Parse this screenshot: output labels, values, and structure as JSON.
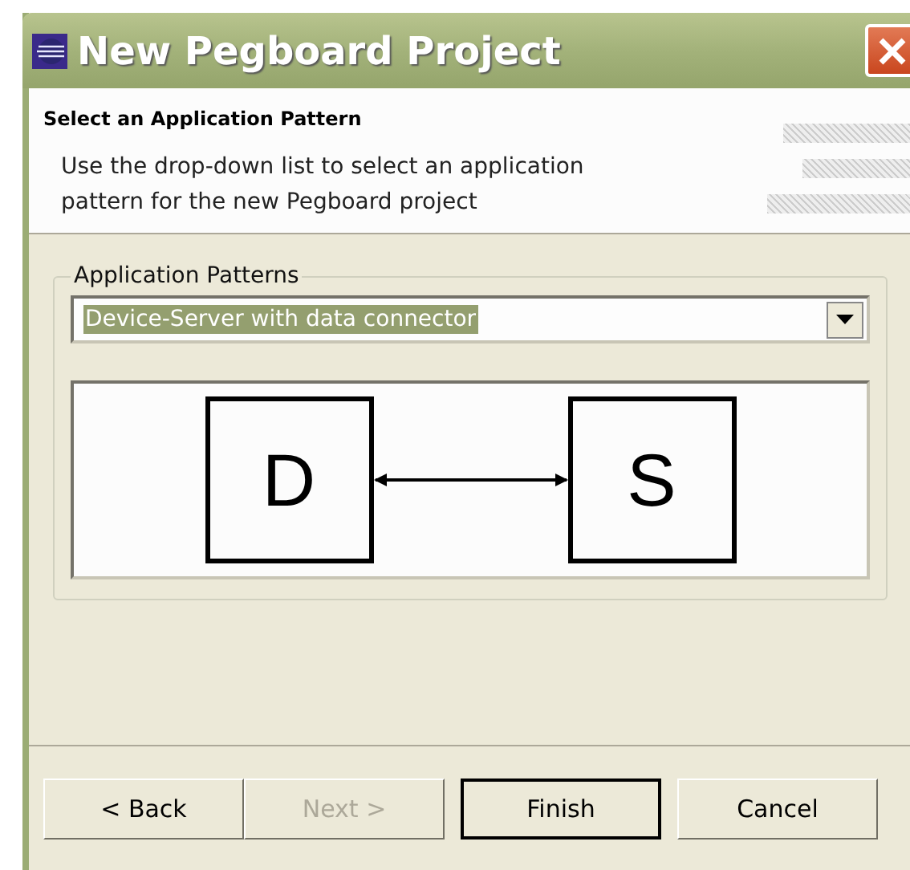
{
  "window": {
    "title": "New Pegboard Project"
  },
  "header": {
    "title": "Select an Application Pattern",
    "description": "Use the drop-down list to select an application pattern for the new Pegboard project"
  },
  "group": {
    "label": "Application Patterns",
    "combo": {
      "value": "Device-Server with data connector",
      "selected": true
    },
    "diagram": {
      "nodes": [
        "D",
        "S"
      ]
    }
  },
  "buttons": [
    {
      "label": "< Back",
      "disabled": false,
      "default": false
    },
    {
      "label": "Next >",
      "disabled": true,
      "default": false
    },
    {
      "label": "Finish",
      "disabled": false,
      "default": true
    },
    {
      "label": "Cancel",
      "disabled": false,
      "default": false
    }
  ]
}
